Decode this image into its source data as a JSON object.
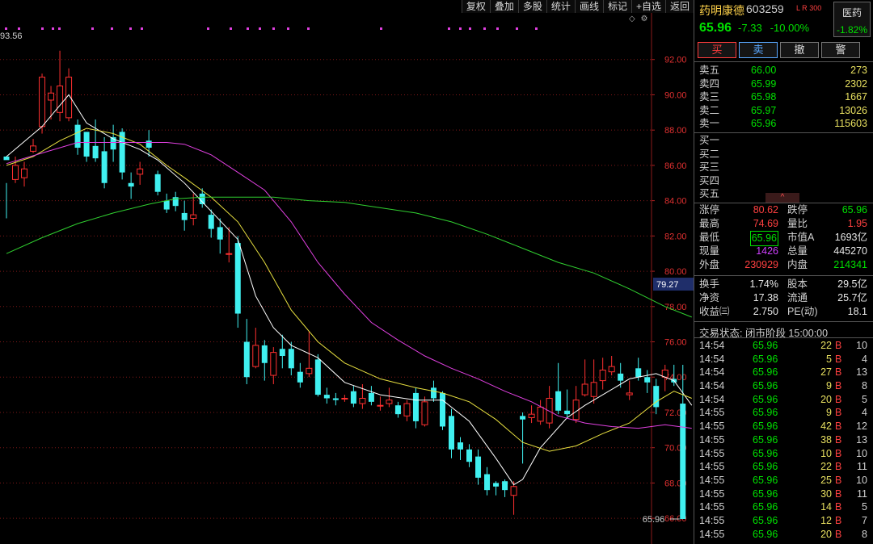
{
  "toolbar": [
    "复权",
    "叠加",
    "多股",
    "统计",
    "画线",
    "标记",
    "+自选",
    "返回"
  ],
  "toolbar_icons": [
    "◇",
    "⚙"
  ],
  "chart_data": {
    "type": "candlestick",
    "period_high_label": "93.56",
    "last_price_label": "65.96",
    "crosshair_price_label": "79.27",
    "ylim": [
      65,
      94
    ],
    "yticks": [
      "92.00",
      "90.00",
      "88.00",
      "86.00",
      "84.00",
      "82.00",
      "80.00",
      "78.00",
      "76.00",
      "74.00",
      "72.00",
      "70.00",
      "68.00",
      "66.00"
    ],
    "colors": {
      "up": "#ff3030",
      "down": "#40f0f0",
      "ma5": "#ffffff",
      "ma10": "#e8e040",
      "ma20": "#e040e0",
      "ma60": "#30d030",
      "grid": "#801818"
    },
    "candles": [
      [
        86.5,
        86.3,
        85.0,
        83.0
      ],
      [
        85.2,
        86.0,
        86.5,
        85.0
      ],
      [
        85.3,
        85.8,
        86.2,
        84.8
      ],
      [
        86.8,
        87.1,
        87.5,
        86.7
      ],
      [
        88.2,
        91.0,
        91.2,
        87.8
      ],
      [
        89.7,
        90.1,
        90.5,
        88.6
      ],
      [
        89.0,
        90.5,
        92.5,
        88.5
      ],
      [
        88.7,
        91.0,
        91.5,
        88.5
      ],
      [
        88.3,
        87.0,
        88.6,
        86.6
      ],
      [
        87.9,
        86.5,
        87.9,
        86.2
      ],
      [
        87.1,
        86.4,
        88.6,
        86.2
      ],
      [
        86.8,
        85.0,
        87.6,
        84.7
      ],
      [
        87.6,
        86.9,
        88.3,
        86.2
      ],
      [
        87.9,
        85.6,
        88.1,
        85.2
      ],
      [
        85.0,
        84.8,
        85.6,
        84.1
      ],
      [
        85.5,
        85.8,
        86.2,
        84.9
      ],
      [
        87.4,
        87.0,
        88.0,
        86.5
      ],
      [
        85.5,
        84.5,
        85.7,
        84.3
      ],
      [
        84.0,
        83.5,
        84.4,
        83.3
      ],
      [
        84.2,
        83.7,
        84.5,
        83.4
      ],
      [
        83.3,
        82.9,
        84.0,
        82.3
      ],
      [
        83.0,
        83.2,
        84.4,
        82.6
      ],
      [
        84.4,
        83.8,
        84.7,
        83.6
      ],
      [
        83.2,
        82.4,
        83.5,
        81.9
      ],
      [
        82.5,
        81.8,
        83.0,
        81.0
      ],
      [
        81.0,
        81.0,
        82.5,
        80.5
      ],
      [
        81.6,
        77.6,
        82.0,
        76.8
      ],
      [
        76.0,
        74.0,
        77.3,
        73.6
      ],
      [
        74.6,
        75.8,
        76.8,
        74.5
      ],
      [
        75.8,
        74.8,
        76.1,
        73.8
      ],
      [
        74.1,
        75.4,
        75.7,
        73.6
      ],
      [
        75.6,
        75.2,
        76.4,
        74.5
      ],
      [
        75.6,
        74.5,
        76.0,
        74.1
      ],
      [
        74.3,
        73.7,
        74.8,
        73.4
      ],
      [
        74.2,
        74.5,
        76.6,
        74.0
      ],
      [
        75.0,
        73.0,
        75.3,
        72.9
      ],
      [
        73.0,
        72.8,
        73.4,
        72.5
      ],
      [
        72.8,
        72.7,
        73.1,
        72.4
      ],
      [
        72.8,
        72.8,
        73.0,
        72.6
      ],
      [
        73.2,
        72.5,
        73.5,
        72.3
      ],
      [
        72.5,
        72.8,
        73.6,
        72.2
      ],
      [
        73.1,
        72.6,
        73.5,
        72.4
      ],
      [
        72.4,
        72.4,
        72.9,
        72.1
      ],
      [
        72.5,
        72.7,
        73.4,
        72.3
      ],
      [
        72.4,
        71.9,
        72.6,
        71.7
      ],
      [
        71.8,
        72.5,
        72.7,
        71.5
      ],
      [
        73.1,
        71.5,
        73.4,
        71.1
      ],
      [
        71.3,
        72.6,
        72.9,
        71.2
      ],
      [
        73.4,
        72.8,
        73.8,
        72.6
      ],
      [
        73.1,
        71.2,
        73.2,
        71.0
      ],
      [
        71.8,
        69.9,
        72.2,
        69.4
      ],
      [
        70.3,
        69.9,
        70.6,
        69.3
      ],
      [
        69.9,
        69.2,
        70.2,
        68.9
      ],
      [
        69.5,
        68.3,
        69.9,
        67.9
      ],
      [
        68.5,
        67.6,
        68.9,
        67.3
      ],
      [
        68.0,
        67.8,
        68.1,
        67.3
      ],
      [
        68.1,
        67.6,
        68.2,
        67.2
      ],
      [
        67.3,
        67.8,
        68.1,
        66.2
      ],
      [
        71.8,
        71.6,
        72.0,
        69.1
      ],
      [
        71.7,
        71.9,
        72.4,
        71.4
      ],
      [
        71.5,
        72.3,
        72.7,
        71.3
      ],
      [
        71.4,
        72.8,
        73.5,
        71.1
      ],
      [
        73.2,
        72.1,
        74.8,
        71.9
      ],
      [
        72.1,
        71.9,
        73.3,
        71.7
      ],
      [
        71.6,
        72.7,
        73.5,
        71.4
      ],
      [
        73.0,
        73.6,
        75.0,
        72.9
      ],
      [
        72.9,
        73.7,
        75.0,
        72.5
      ],
      [
        73.8,
        74.4,
        75.1,
        73.3
      ],
      [
        74.3,
        74.6,
        75.2,
        74.1
      ],
      [
        74.2,
        73.8,
        74.8,
        73.4
      ],
      [
        73.0,
        73.1,
        73.8,
        72.7
      ],
      [
        74.5,
        74.0,
        75.1,
        73.8
      ],
      [
        74.0,
        73.7,
        74.4,
        73.1
      ],
      [
        73.5,
        72.3,
        73.9,
        71.9
      ],
      [
        74.0,
        74.4,
        74.7,
        73.2
      ],
      [
        73.9,
        73.7,
        74.7,
        73.5
      ],
      [
        72.5,
        65.96,
        74.7,
        65.96
      ]
    ],
    "ma_lines": {
      "ma5": [
        [
          0,
          86.5
        ],
        [
          4,
          88.2
        ],
        [
          7,
          90.0
        ],
        [
          9,
          88.4
        ],
        [
          12,
          87.5
        ],
        [
          15,
          86.9
        ],
        [
          17,
          86.3
        ],
        [
          20,
          85.0
        ],
        [
          23,
          83.4
        ],
        [
          26,
          81.8
        ],
        [
          28,
          78.6
        ],
        [
          30,
          76.8
        ],
        [
          32,
          75.8
        ],
        [
          35,
          75.1
        ],
        [
          38,
          73.7
        ],
        [
          42,
          73.0
        ],
        [
          46,
          72.7
        ],
        [
          49,
          72.7
        ],
        [
          52,
          71.5
        ],
        [
          55,
          69.4
        ],
        [
          57,
          67.9
        ],
        [
          58,
          68.2
        ],
        [
          60,
          70.0
        ],
        [
          63,
          71.7
        ],
        [
          65,
          72.4
        ],
        [
          67,
          73.0
        ],
        [
          70,
          73.9
        ],
        [
          73,
          74.2
        ],
        [
          75,
          73.8
        ],
        [
          77,
          72.4
        ]
      ],
      "ma10": [
        [
          0,
          86.0
        ],
        [
          3,
          86.5
        ],
        [
          6,
          87.4
        ],
        [
          9,
          88.1
        ],
        [
          12,
          87.8
        ],
        [
          15,
          87.2
        ],
        [
          18,
          86.0
        ],
        [
          20,
          85.3
        ],
        [
          23,
          84.2
        ],
        [
          26,
          82.8
        ],
        [
          29,
          80.5
        ],
        [
          32,
          77.8
        ],
        [
          35,
          76.0
        ],
        [
          38,
          74.8
        ],
        [
          42,
          73.9
        ],
        [
          46,
          73.4
        ],
        [
          49,
          73.1
        ],
        [
          52,
          72.6
        ],
        [
          55,
          71.6
        ],
        [
          58,
          70.3
        ],
        [
          61,
          69.8
        ],
        [
          64,
          70.1
        ],
        [
          67,
          70.8
        ],
        [
          70,
          71.4
        ],
        [
          73,
          72.6
        ],
        [
          75,
          73.2
        ],
        [
          77,
          72.8
        ]
      ],
      "ma20": [
        [
          0,
          86.1
        ],
        [
          4,
          86.7
        ],
        [
          8,
          87.3
        ],
        [
          12,
          87.3
        ],
        [
          15,
          87.3
        ],
        [
          18,
          87.3
        ],
        [
          20,
          87.2
        ],
        [
          23,
          86.6
        ],
        [
          26,
          85.6
        ],
        [
          29,
          84.6
        ],
        [
          32,
          82.8
        ],
        [
          35,
          80.5
        ],
        [
          38,
          78.7
        ],
        [
          41,
          77.1
        ],
        [
          44,
          76.1
        ],
        [
          47,
          75.2
        ],
        [
          50,
          74.5
        ],
        [
          53,
          73.9
        ],
        [
          56,
          73.2
        ],
        [
          59,
          72.6
        ],
        [
          62,
          71.8
        ],
        [
          65,
          71.4
        ],
        [
          68,
          71.2
        ],
        [
          71,
          71.1
        ],
        [
          74,
          71.3
        ],
        [
          77,
          71.1
        ]
      ],
      "ma60": [
        [
          0,
          81.0
        ],
        [
          4,
          81.9
        ],
        [
          8,
          82.7
        ],
        [
          12,
          83.3
        ],
        [
          16,
          83.8
        ],
        [
          19,
          84.1
        ],
        [
          22,
          84.2
        ],
        [
          26,
          84.2
        ],
        [
          30,
          84.2
        ],
        [
          34,
          84.0
        ],
        [
          38,
          83.9
        ],
        [
          42,
          83.6
        ],
        [
          46,
          83.3
        ],
        [
          50,
          82.8
        ],
        [
          54,
          82.1
        ],
        [
          58,
          81.3
        ],
        [
          62,
          80.5
        ],
        [
          66,
          79.9
        ],
        [
          70,
          79.0
        ],
        [
          74,
          78.0
        ],
        [
          77,
          77.4
        ]
      ]
    },
    "markers": [
      6,
      22,
      51,
      64,
      72,
      113,
      137,
      160,
      174,
      256,
      284,
      305,
      320,
      337,
      355,
      380,
      470,
      554,
      568,
      580,
      598,
      614,
      638,
      662
    ]
  },
  "side": {
    "name": "药明康德",
    "code": "603259",
    "tag_lr": "L R",
    "tag_300": "300",
    "sector_name": "医药",
    "sector_pct": "-1.82%",
    "price": "65.96",
    "change": "-7.33",
    "change_pct": "-10.00%",
    "trade_buttons": [
      "买",
      "卖",
      "撤",
      "警"
    ],
    "asks": [
      {
        "label": "卖五",
        "price": "66.00",
        "vol": "273"
      },
      {
        "label": "卖四",
        "price": "65.99",
        "vol": "2302"
      },
      {
        "label": "卖三",
        "price": "65.98",
        "vol": "1667"
      },
      {
        "label": "卖二",
        "price": "65.97",
        "vol": "13026"
      },
      {
        "label": "卖一",
        "price": "65.96",
        "vol": "115603"
      }
    ],
    "bids": [
      {
        "label": "买一",
        "price": "",
        "vol": ""
      },
      {
        "label": "买二",
        "price": "",
        "vol": ""
      },
      {
        "label": "买三",
        "price": "",
        "vol": ""
      },
      {
        "label": "买四",
        "price": "",
        "vol": ""
      },
      {
        "label": "买五",
        "price": "",
        "vol": ""
      }
    ],
    "collapse": "^",
    "stats1": [
      {
        "l1": "涨停",
        "v1": "80.62",
        "c1": "red",
        "l2": "跌停",
        "v2": "65.96",
        "c2": "green"
      },
      {
        "l1": "最高",
        "v1": "74.69",
        "c1": "red",
        "l2": "量比",
        "v2": "1.95",
        "c2": "red"
      },
      {
        "l1": "最低",
        "v1": "65.96",
        "c1": "green boxed",
        "l2": "市值A",
        "v2": "1693亿",
        "c2": "white"
      },
      {
        "l1": "现量",
        "v1": "1426",
        "c1": "purple",
        "l2": "总量",
        "v2": "445270",
        "c2": "white"
      },
      {
        "l1": "外盘",
        "v1": "230929",
        "c1": "red",
        "l2": "内盘",
        "v2": "214341",
        "c2": "green"
      }
    ],
    "stats2": [
      {
        "l1": "换手",
        "v1": "1.74%",
        "c1": "white",
        "l2": "股本",
        "v2": "29.5亿",
        "c2": "white"
      },
      {
        "l1": "净资",
        "v1": "17.38",
        "c1": "white",
        "l2": "流通",
        "v2": "25.7亿",
        "c2": "white"
      },
      {
        "l1": "收益㈢",
        "v1": "2.750",
        "c1": "white",
        "l2": "PE(动)",
        "v2": "18.1",
        "c2": "white"
      }
    ],
    "status": "交易状态: 闭市阶段 15:00:00",
    "ticks": [
      {
        "t": "14:54",
        "p": "65.96",
        "v": "22",
        "b": "B",
        "c": "10"
      },
      {
        "t": "14:54",
        "p": "65.96",
        "v": "5",
        "b": "B",
        "c": "4"
      },
      {
        "t": "14:54",
        "p": "65.96",
        "v": "27",
        "b": "B",
        "c": "13"
      },
      {
        "t": "14:54",
        "p": "65.96",
        "v": "9",
        "b": "B",
        "c": "8"
      },
      {
        "t": "14:54",
        "p": "65.96",
        "v": "20",
        "b": "B",
        "c": "5"
      },
      {
        "t": "14:55",
        "p": "65.96",
        "v": "9",
        "b": "B",
        "c": "4"
      },
      {
        "t": "14:55",
        "p": "65.96",
        "v": "42",
        "b": "B",
        "c": "12"
      },
      {
        "t": "14:55",
        "p": "65.96",
        "v": "38",
        "b": "B",
        "c": "13"
      },
      {
        "t": "14:55",
        "p": "65.96",
        "v": "10",
        "b": "B",
        "c": "10"
      },
      {
        "t": "14:55",
        "p": "65.96",
        "v": "22",
        "b": "B",
        "c": "11"
      },
      {
        "t": "14:55",
        "p": "65.96",
        "v": "25",
        "b": "B",
        "c": "10"
      },
      {
        "t": "14:55",
        "p": "65.96",
        "v": "30",
        "b": "B",
        "c": "11"
      },
      {
        "t": "14:55",
        "p": "65.96",
        "v": "14",
        "b": "B",
        "c": "5"
      },
      {
        "t": "14:55",
        "p": "65.96",
        "v": "12",
        "b": "B",
        "c": "7"
      },
      {
        "t": "14:55",
        "p": "65.96",
        "v": "20",
        "b": "B",
        "c": "8"
      }
    ]
  }
}
